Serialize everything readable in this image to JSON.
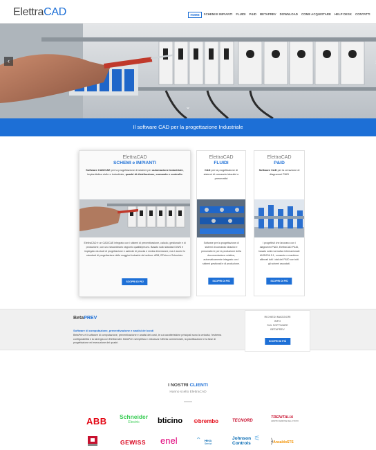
{
  "header": {
    "logo_part1": "Elettra",
    "logo_part2": "CAD",
    "nav": [
      "Home",
      "Schemi e Impianti",
      "Fluidi",
      "P&ID",
      "BetaPrev",
      "Download",
      "Come acquistare",
      "Help Desk",
      "Contatti"
    ]
  },
  "hero": {
    "prev_icon": "chevron-left-icon",
    "next_icon": "chevron-right-icon",
    "scroll_icon": "chevron-down-icon"
  },
  "banner": {
    "text": "Il software CAD per la progettazione Industriale"
  },
  "cards": [
    {
      "brand": "ElettraCAD",
      "title": "SCHEMI e IMPIANTI",
      "desc_html_parts": [
        "Software CAD/CAE",
        " per la progettazione di sistemi per ",
        "automazione industriale",
        ", impiantistica civile e industriale, ",
        "quadri di distribuzione, comando e controllo"
      ],
      "body": "ElettraCAD è un CAD/CAE integrato con i sistemi di preventivazione, calcolo, gestionale e di produzione, con uno straordinario rapporto qualità/prezzo. Basato sullo standard DWG è impiegato da studi di progettazione e aziende di piccola e media dimensione, ma è anche lo standard di progettazione delle maggiori industrie del settore: ABB, BTicino e Schneider.",
      "button": "SCOPRI DI PIÙ"
    },
    {
      "brand": "ElettraCAD",
      "title": "FLUIDI",
      "desc_parts": [
        "CAD",
        " per la progettazione di sistemi di comando idraulici e pneumatici"
      ],
      "body": "Software per la progettazione di sistemi di comando idraulici e pneumatici e per la produzione della documentazione relativa, automaticamente integrato con i sistemi gestionali e di produzione.",
      "button": "SCOPRI DI PIÙ"
    },
    {
      "brand": "ElettraCAD",
      "title": "P&ID",
      "desc_parts": [
        "Software CAD",
        " per la creazione di diagrammi P&ID"
      ],
      "body": "I progettisti che lavorano con i diagrammi P&ID, ElettraCAD P&ID, basato sulla normativa internazionale ANSI/ISA 5.1, consente e mantiene allineati tutti i dati del P&ID con tutti gli schemi associati.",
      "button": "SCOPRI DI PIÙ"
    }
  ],
  "beta": {
    "title_part1": "Beta",
    "title_part2": "PREV",
    "subtitle": "Software di computazione, preventivazione e analisi dei costi",
    "text": "BetaPrev è il software di computazione, preventivazione e analisi dei costi, le cui caratteristiche principali sono la velocità, l'estrema configurabilità e la sinergia con ElettraCAD. BetaPrev semplifica e velocizza l'offerta commerciale, la pianificazione e la fase di progettazione ed esecuzione dei quadri.",
    "side_lines": [
      "RICHIEDI MAGGIORI",
      "INFO",
      "SUL SOFTWARE",
      "BETAPREV"
    ],
    "side_button": "SCOPRI DI PIÙ"
  },
  "clients": {
    "title_part1": "I NOSTRI ",
    "title_part2": "CLIENTI",
    "subtitle": "Hanno scelto ElettraCAD",
    "logos_row1": [
      "ABB",
      "Schneider",
      "Electric",
      "bticino",
      "brembo",
      "TECNORD",
      "TRENITALIA",
      "GRUPPO FERROVIE DELLO STATO"
    ],
    "logos_row2": [
      "GEWISS",
      "enel",
      "Hera",
      "Servizi",
      "Johnson",
      "Controls",
      "AnsaldoSTS"
    ],
    "colors": {
      "abb": "#e30613",
      "schneider": "#3dcd58",
      "bticino": "#000000",
      "brembo": "#e30613",
      "tecnord": "#c8102e",
      "trenitalia": "#c8102e",
      "gewiss": "#d9001b",
      "enel": "#e0007a",
      "hera": "#0067b1",
      "johnson": "#0067b1",
      "ansaldo": "#f39200"
    }
  }
}
